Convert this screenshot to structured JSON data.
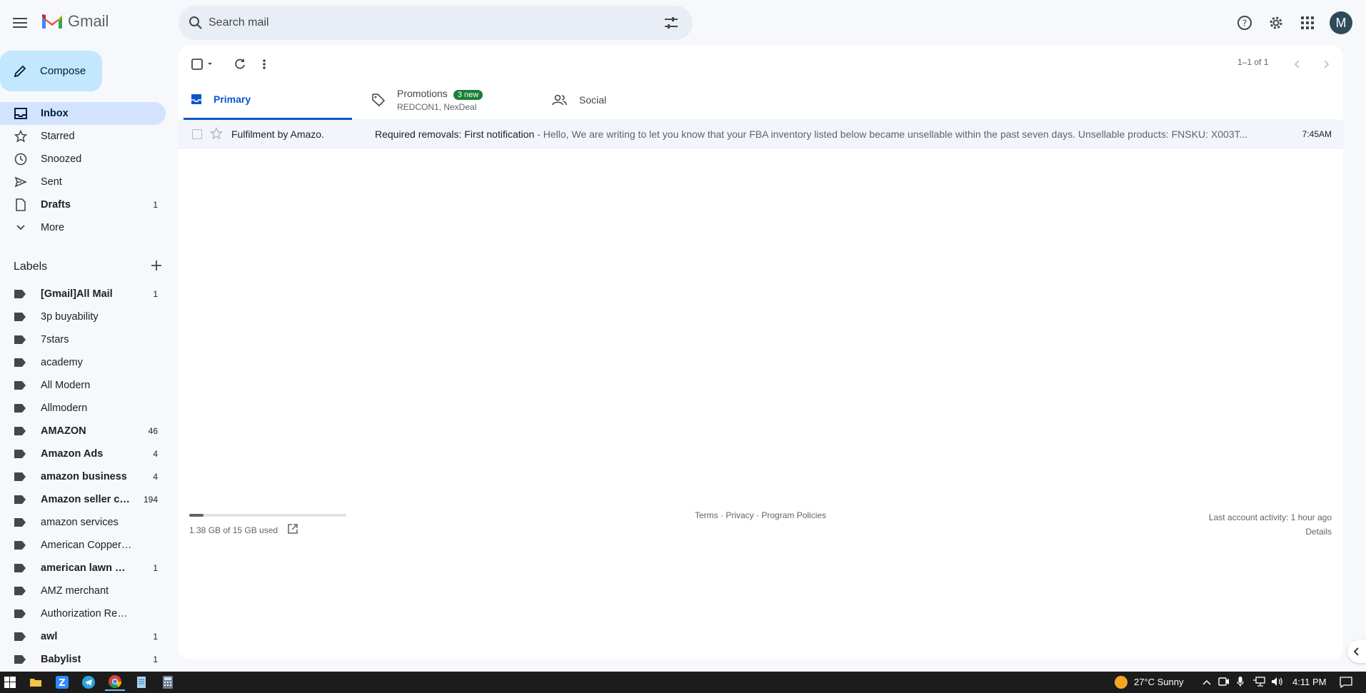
{
  "app": {
    "name": "Gmail"
  },
  "search": {
    "placeholder": "Search mail"
  },
  "header": {
    "avatar_letter": "M"
  },
  "compose_label": "Compose",
  "nav": [
    {
      "label": "Inbox",
      "count": "",
      "icon": "inbox-icon"
    },
    {
      "label": "Starred",
      "count": "",
      "icon": "star-icon"
    },
    {
      "label": "Snoozed",
      "count": "",
      "icon": "clock-icon"
    },
    {
      "label": "Sent",
      "count": "",
      "icon": "send-icon"
    },
    {
      "label": "Drafts",
      "count": "1",
      "icon": "draft-icon"
    },
    {
      "label": "More",
      "count": "",
      "icon": "chevron-down-icon"
    }
  ],
  "labels_title": "Labels",
  "labels": [
    {
      "name": "[Gmail]All Mail",
      "count": "1"
    },
    {
      "name": "3p buyability",
      "count": ""
    },
    {
      "name": "7stars",
      "count": ""
    },
    {
      "name": "academy",
      "count": ""
    },
    {
      "name": "All Modern",
      "count": ""
    },
    {
      "name": "Allmodern",
      "count": ""
    },
    {
      "name": "AMAZON",
      "count": "46"
    },
    {
      "name": "Amazon Ads",
      "count": "4"
    },
    {
      "name": "amazon business",
      "count": "4"
    },
    {
      "name": "Amazon seller ce...",
      "count": "194"
    },
    {
      "name": "amazon services",
      "count": ""
    },
    {
      "name": "American Copper Brass",
      "count": ""
    },
    {
      "name": "american lawn mo...",
      "count": "1"
    },
    {
      "name": "AMZ merchant",
      "count": ""
    },
    {
      "name": "Authorization Request",
      "count": ""
    },
    {
      "name": "awl",
      "count": "1"
    },
    {
      "name": "Babylist",
      "count": "1"
    }
  ],
  "pager": {
    "text": "1–1 of 1"
  },
  "tabs": [
    {
      "label": "Primary",
      "sub": "",
      "badge": ""
    },
    {
      "label": "Promotions",
      "sub": "REDCON1, NexDeal",
      "badge": "3 new"
    },
    {
      "label": "Social",
      "sub": "",
      "badge": ""
    }
  ],
  "emails": [
    {
      "sender": "Fulfilment by Amazo.",
      "subject": "Required removals: First notification",
      "separator": " - ",
      "snippet": "Hello, We are writing to let you know that your FBA inventory listed below became unsellable within the past seven days. Unsellable products: FNSKU: X003T...",
      "time": "7:45AM"
    }
  ],
  "footer": {
    "storage": "1.38 GB of 15 GB used",
    "storage_fraction": 0.092,
    "terms": "Terms",
    "dot1": " · ",
    "privacy": "Privacy",
    "dot2": " · ",
    "policies": "Program Policies",
    "activity": "Last account activity: 1 hour ago",
    "details": "Details"
  },
  "taskbar": {
    "weather": "27°C  Sunny",
    "time": "4:11 PM"
  },
  "colors": {
    "accent": "#0b57d0",
    "compose_bg": "#c2e7ff",
    "active_nav": "#d3e3fd",
    "badge": "#188038"
  }
}
